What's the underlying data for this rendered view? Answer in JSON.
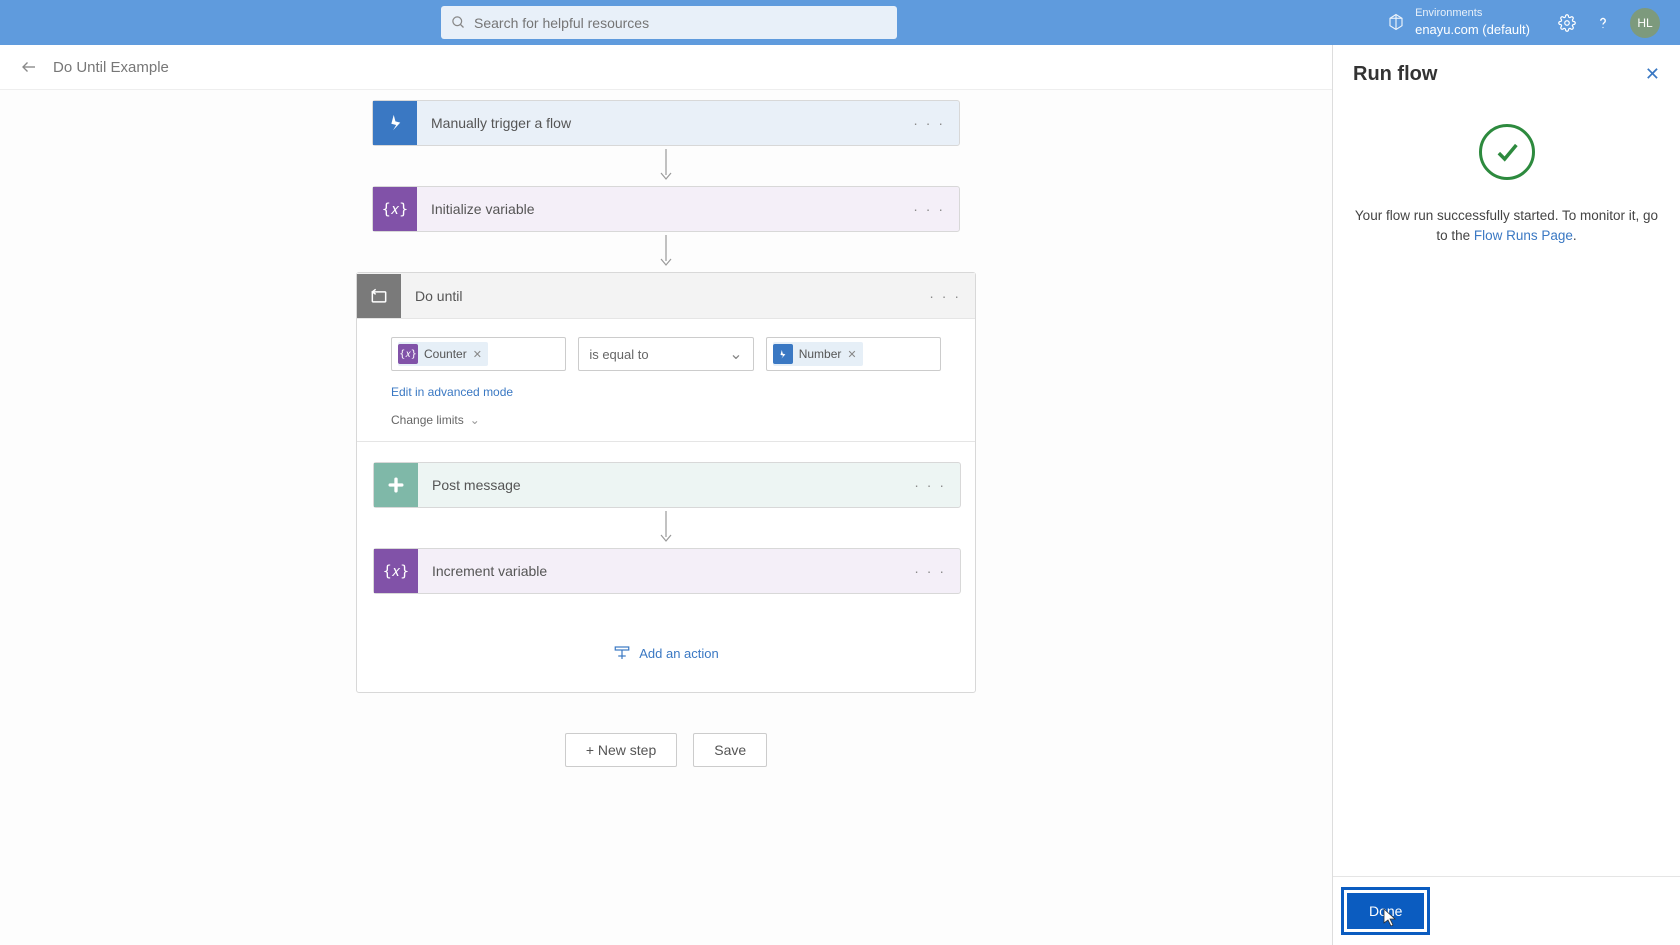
{
  "header": {
    "search_placeholder": "Search for helpful resources",
    "env_label": "Environments",
    "env_value": "enayu.com (default)",
    "avatar_initials": "HL"
  },
  "breadcrumb": {
    "flow_name": "Do Until Example"
  },
  "steps": {
    "trigger": {
      "title": "Manually trigger a flow"
    },
    "init_var": {
      "title": "Initialize variable"
    },
    "do_until": {
      "title": "Do until",
      "left_token": "Counter",
      "operator": "is equal to",
      "right_token": "Number",
      "adv_link": "Edit in advanced mode",
      "limits_link": "Change limits"
    },
    "post_msg": {
      "title": "Post message"
    },
    "inc_var": {
      "title": "Increment variable"
    },
    "add_action": "Add an action"
  },
  "buttons": {
    "new_step": "+ New step",
    "save": "Save"
  },
  "panel": {
    "title": "Run flow",
    "message_pre": "Your flow run successfully started. To monitor it, go to the ",
    "message_link": "Flow Runs Page",
    "message_post": ".",
    "done": "Done"
  }
}
